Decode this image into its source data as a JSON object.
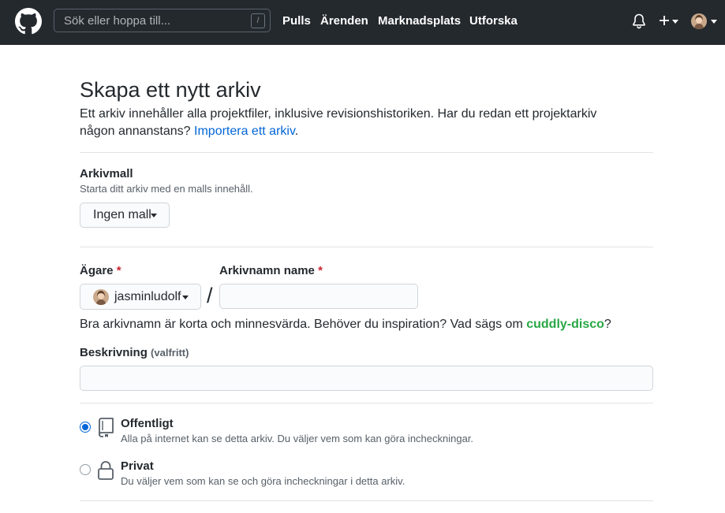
{
  "header": {
    "search_placeholder": "Sök eller hoppa till...",
    "search_shortcut": "/",
    "nav": [
      "Pulls",
      "Ärenden",
      "Marknadsplats",
      "Utforska"
    ]
  },
  "page": {
    "title": "Skapa ett nytt arkiv",
    "desc_text": "Ett arkiv innehåller alla projektfiler, inklusive revisionshistoriken. Har du redan ett projektarkiv någon annanstans? ",
    "import_link": "Importera ett arkiv",
    "import_suffix": "."
  },
  "template": {
    "label": "Arkivmall",
    "note": "Starta ditt arkiv med en malls innehåll.",
    "button": "Ingen mall"
  },
  "owner": {
    "label": "Ägare",
    "value": "jasminludolf"
  },
  "repo_name": {
    "label": "Arkivnamn name",
    "required_mark": "*",
    "value": ""
  },
  "separator": "/",
  "hint": {
    "text": "Bra arkivnamn är korta och minnesvärda. Behöver du inspiration? Vad sägs om ",
    "suggestion": "cuddly-disco",
    "suffix": "?"
  },
  "description": {
    "label": "Beskrivning",
    "optional": "(valfritt)",
    "value": ""
  },
  "visibility": {
    "public": {
      "title": "Offentligt",
      "desc": "Alla på internet kan se detta arkiv. Du väljer vem som kan göra incheckningar.",
      "checked": true
    },
    "private": {
      "title": "Privat",
      "desc": "Du väljer vem som kan se och göra incheckningar i detta arkiv.",
      "checked": false
    }
  },
  "colors": {
    "header_bg": "#24292e",
    "link": "#0366d6",
    "suggestion": "#28a745",
    "required": "#cb2431"
  }
}
